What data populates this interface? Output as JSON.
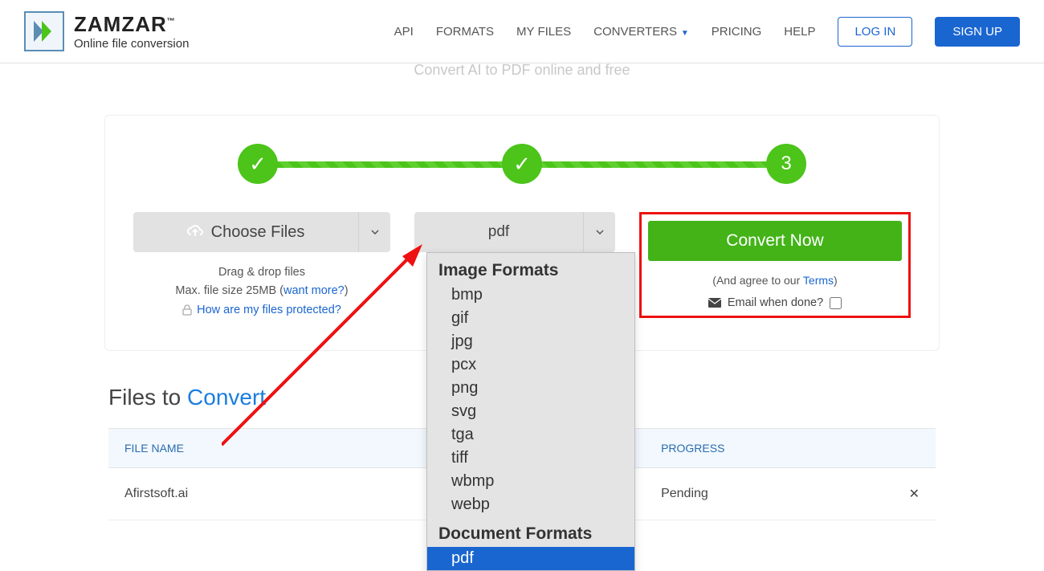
{
  "header": {
    "brand": "ZAMZAR",
    "tagline": "Online file conversion",
    "nav": {
      "api": "API",
      "formats": "FORMATS",
      "myfiles": "MY FILES",
      "converters": "CONVERTERS",
      "pricing": "PRICING",
      "help": "HELP"
    },
    "login": "LOG IN",
    "signup": "SIGN UP"
  },
  "subtitle": "Convert AI to PDF online and free",
  "stepper": {
    "s1": "✓",
    "s2": "✓",
    "s3": "3"
  },
  "choose": {
    "label": "Choose Files",
    "drag": "Drag & drop files",
    "maxsize_prefix": "Max. file size 25MB (",
    "maxsize_link": "want more?",
    "maxsize_suffix": ")",
    "protect_link": "How are my files protected?"
  },
  "format": {
    "selected": "pdf"
  },
  "convert": {
    "button": "Convert Now",
    "agree_prefix": "(And agree to our ",
    "agree_link": "Terms",
    "agree_suffix": ")",
    "email_label": "Email when done?"
  },
  "dropdown": {
    "header1": "Image Formats",
    "items1": [
      "bmp",
      "gif",
      "jpg",
      "pcx",
      "png",
      "svg",
      "tga",
      "tiff",
      "wbmp",
      "webp"
    ],
    "header2": "Document Formats",
    "items2_sel": "pdf"
  },
  "files": {
    "title_a": "Files to ",
    "title_b": "Convert",
    "th_name": "FILE NAME",
    "th_prog": "PROGRESS",
    "rows": [
      {
        "name": "Afirstsoft.ai",
        "progress": "Pending"
      }
    ]
  }
}
